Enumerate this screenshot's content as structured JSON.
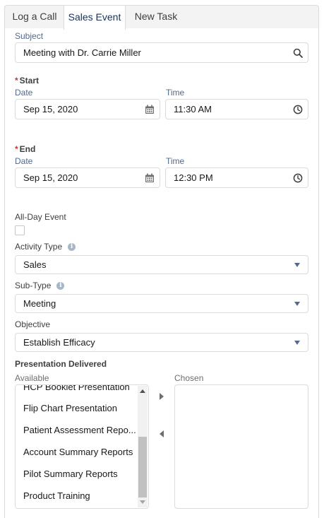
{
  "tabs": [
    {
      "label": "Log a Call"
    },
    {
      "label": "Sales Event"
    },
    {
      "label": "New Task"
    }
  ],
  "subject": {
    "label": "Subject",
    "value": "Meeting with Dr. Carrie Miller"
  },
  "start": {
    "title": "Start",
    "date_label": "Date",
    "date_value": "Sep 15, 2020",
    "time_label": "Time",
    "time_value": "11:30 AM"
  },
  "end": {
    "title": "End",
    "date_label": "Date",
    "date_value": "Sep 15, 2020",
    "time_label": "Time",
    "time_value": "12:30 PM"
  },
  "all_day": {
    "label": "All-Day Event",
    "checked": false
  },
  "activity_type": {
    "label": "Activity Type",
    "value": "Sales"
  },
  "sub_type": {
    "label": "Sub-Type",
    "value": "Meeting"
  },
  "objective": {
    "label": "Objective",
    "value": "Establish Efficacy"
  },
  "presentation": {
    "title": "Presentation Delivered",
    "available_label": "Available",
    "chosen_label": "Chosen",
    "available_items": [
      "HCP Booklet Presentation",
      "Flip Chart Presentation",
      "Patient Assessment Repo...",
      "Account Summary Reports",
      "Pilot Summary Reports",
      "Product Training"
    ],
    "chosen_items": []
  },
  "icons": {
    "search": "search-icon",
    "calendar": "calendar-icon",
    "clock": "clock-icon",
    "info": "info-icon",
    "dropdown": "chevron-down-icon"
  },
  "colors": {
    "required": "#c23934",
    "active_tab_text": "#16325c",
    "label": "#54698d",
    "border": "#dddbda"
  }
}
